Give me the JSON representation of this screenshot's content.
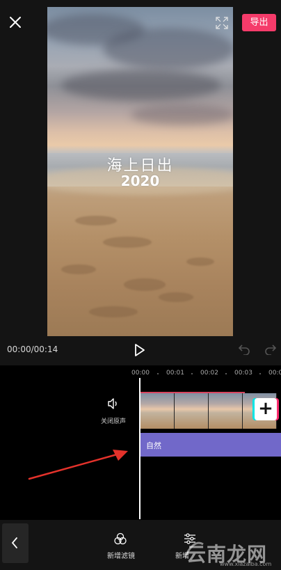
{
  "header": {
    "export_label": "导出"
  },
  "video": {
    "title": "海上日出",
    "year": "2020"
  },
  "player": {
    "time": "00:00/00:14"
  },
  "timeline": {
    "ruler": [
      "00:00",
      "00:01",
      "00:02",
      "00:03",
      "00:0"
    ],
    "mute_label": "关闭原声",
    "add_label": "+",
    "filter_clip_label": "自然"
  },
  "toolbar": {
    "items": [
      {
        "label": "新增滤镜",
        "icon": "filter-icon"
      },
      {
        "label": "新增",
        "icon": "adjust-icon"
      }
    ]
  },
  "watermark": {
    "brand": "云南龙网",
    "url": "www.xiazaiba.com"
  },
  "colors": {
    "accent": "#f53b6a",
    "filter_track": "#7168c9",
    "background": "#141414"
  }
}
